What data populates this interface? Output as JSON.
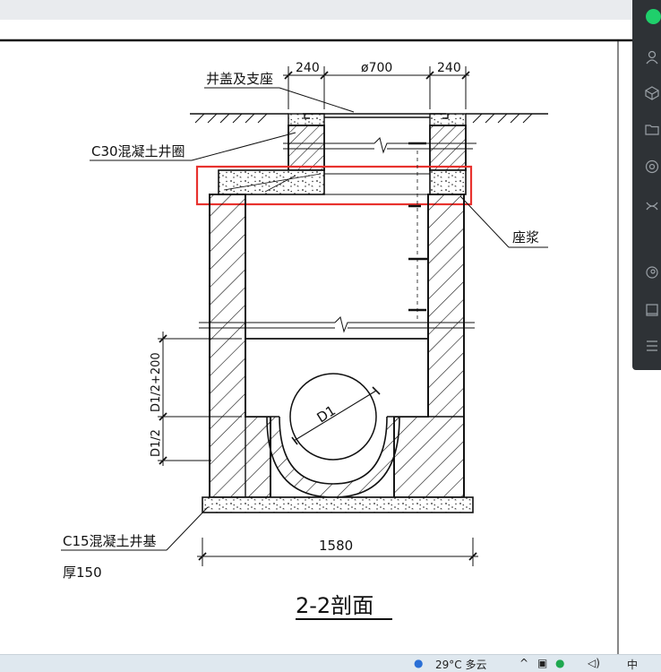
{
  "drawing": {
    "title": "2-2剖面",
    "labels": {
      "cover_support": "井盖及支座",
      "ring": "C30混凝土井圈",
      "mortar": "座浆",
      "base_line1": "C15混凝土井基",
      "base_line2": "厚150"
    },
    "dimensions": {
      "left_wall": "240",
      "opening": "ø700",
      "right_wall": "240",
      "overall_width": "1580",
      "pipe_diameter": "D1",
      "lower_height": "D1/2",
      "upper_height": "D1/2+200"
    },
    "highlight_color": "#e8322e"
  },
  "taskbar": {
    "weather": "29°C 多云",
    "ime": "中"
  }
}
